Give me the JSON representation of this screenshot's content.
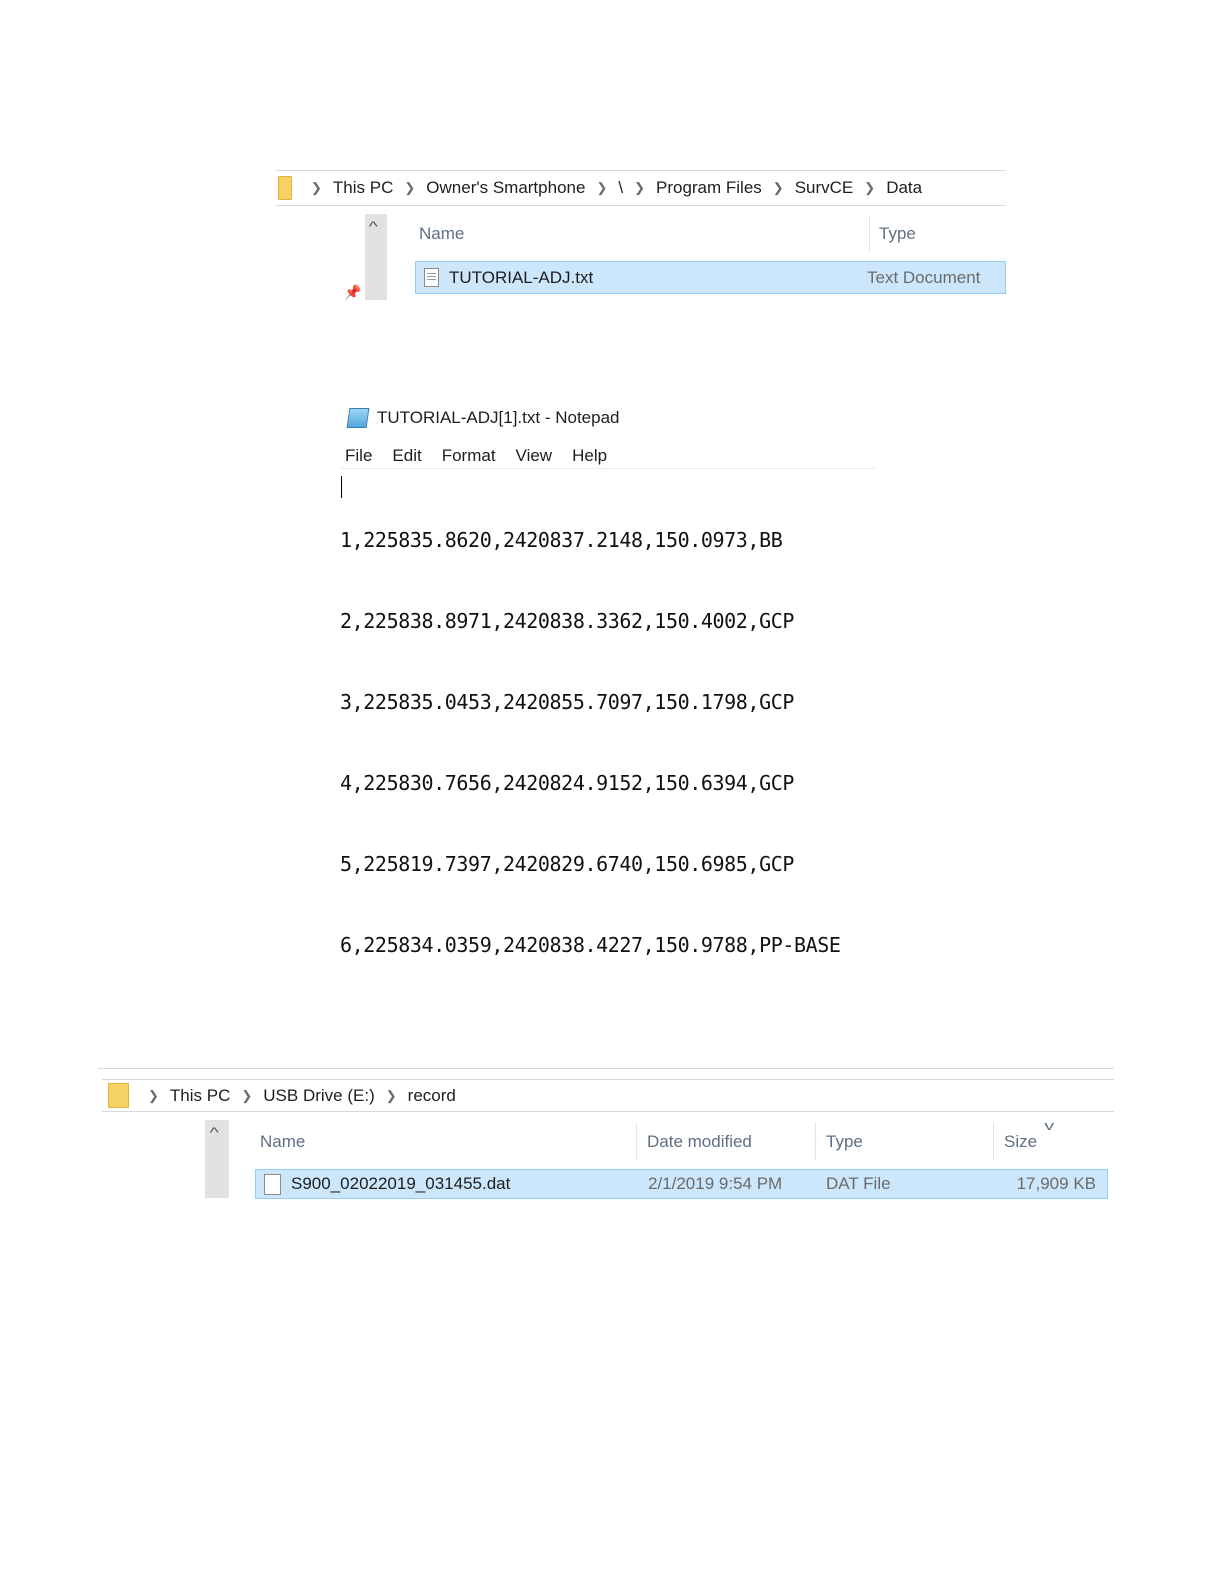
{
  "explorer_1": {
    "breadcrumb": [
      "This PC",
      "Owner's Smartphone",
      "\\",
      "Program Files",
      "SurvCE",
      "Data"
    ],
    "columns": {
      "name": "Name",
      "type": "Type"
    },
    "rows": [
      {
        "name": "TUTORIAL-ADJ.txt",
        "type": "Text Document",
        "selected": true
      }
    ]
  },
  "notepad": {
    "title": "TUTORIAL-ADJ[1].txt - Notepad",
    "menu": [
      "File",
      "Edit",
      "Format",
      "View",
      "Help"
    ],
    "lines": [
      "1,225835.8620,2420837.2148,150.0973,BB",
      "2,225838.8971,2420838.3362,150.4002,GCP",
      "3,225835.0453,2420855.7097,150.1798,GCP",
      "4,225830.7656,2420824.9152,150.6394,GCP",
      "5,225819.7397,2420829.6740,150.6985,GCP",
      "6,225834.0359,2420838.4227,150.9788,PP-BASE"
    ]
  },
  "explorer_2": {
    "breadcrumb": [
      "This PC",
      "USB Drive (E:)",
      "record"
    ],
    "columns": {
      "name": "Name",
      "date_modified": "Date modified",
      "type": "Type",
      "size": "Size"
    },
    "rows": [
      {
        "name": "S900_02022019_031455.dat",
        "date_modified": "2/1/2019 9:54 PM",
        "type": "DAT File",
        "size": "17,909 KB",
        "selected": true
      }
    ]
  },
  "colors": {
    "selection_fill": "#cce6fb",
    "selection_border": "#9acbf2",
    "folder": "#f6d265",
    "header_text": "#5e6f84"
  }
}
